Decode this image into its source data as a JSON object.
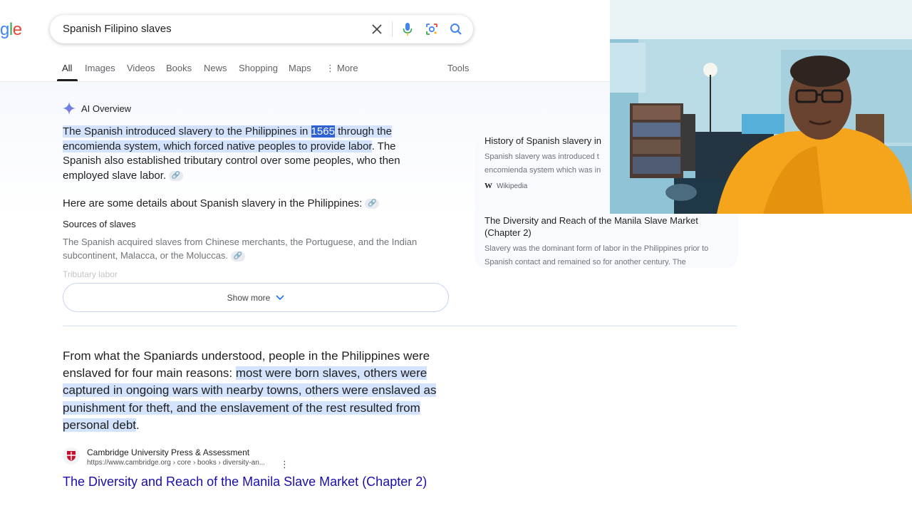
{
  "search": {
    "logo_partial": "gle",
    "query": "Spanish Filipino slaves"
  },
  "tabs": [
    {
      "label": "All"
    },
    {
      "label": "Images"
    },
    {
      "label": "Videos"
    },
    {
      "label": "Books"
    },
    {
      "label": "News"
    },
    {
      "label": "Shopping"
    },
    {
      "label": "Maps"
    },
    {
      "label": "More"
    }
  ],
  "tools_label": "Tools",
  "ai_overview": {
    "label": "AI Overview",
    "para_a": "The Spanish introduced slavery to the Philippines in ",
    "para_year": "1565",
    "para_b": " through the encomienda system, which forced native peoples to provide labor",
    "para_c": ". The Spanish also established tributary control over some peoples, who then employed slave labor.",
    "details_heading": "Here are some details about Spanish slavery in the Philippines:",
    "sources_heading": "Sources of slaves",
    "sources_text": "The Spanish acquired slaves from Chinese merchants, the Portuguese, and the Indian subcontinent, Malacca, or the Moluccas.",
    "faded_line": "Tributary labor",
    "show_more": "Show more"
  },
  "side_sources": [
    {
      "title": "History of Spanish slavery in",
      "text": "Spanish slavery was introduced t encomienda system which was in",
      "source": "Wikipedia"
    },
    {
      "title": "The Diversity and Reach of the Manila Slave Market (Chapter 2)",
      "text": "Slavery was the dominant form of labor in the Philippines prior to Spanish contact and remained so for another century. The"
    }
  ],
  "snippet": {
    "plain": "From what the Spaniards understood, people in the Philippines were enslaved for four main reasons: ",
    "highlight": "most were born slaves, others were captured in ongoing wars with nearby towns, others were enslaved as punishment for theft, and the enslavement of the rest resulted from personal debt",
    "end": "."
  },
  "result": {
    "site_name": "Cambridge University Press & Assessment",
    "url": "https://www.cambridge.org › core › books › diversity-an...",
    "title": "The Diversity and Reach of the Manila Slave Market (Chapter 2)"
  },
  "colors": {
    "highlight": "#d3e3fd",
    "highlight_strong": "#2f62d3",
    "link": "#1a0dab"
  }
}
